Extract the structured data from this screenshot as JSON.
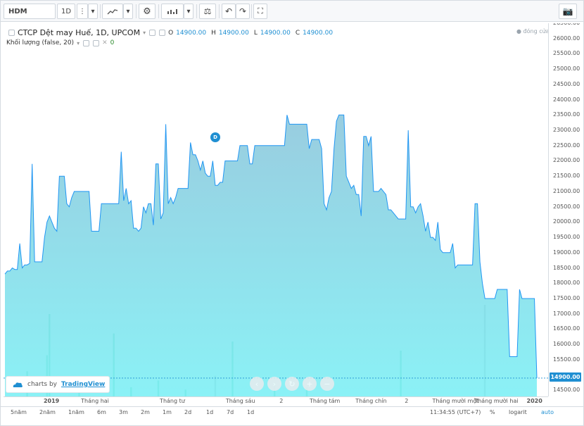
{
  "toolbar": {
    "symbol": "HDM",
    "interval": "1D",
    "icons": [
      "more-dots-icon",
      "chevron-down-icon",
      "line-chart-icon",
      "gear-icon",
      "indicators-icon",
      "compare-scale-icon",
      "undo-icon",
      "redo-icon",
      "fullscreen-icon",
      "camera-icon"
    ]
  },
  "legend": {
    "title": "CTCP Dệt may Huế, 1D, UPCOM",
    "open_key": "O",
    "open": "14900.00",
    "high_key": "H",
    "high": "14900.00",
    "low_key": "L",
    "low": "14900.00",
    "close_key": "C",
    "close": "14900.00",
    "volume_title": "Khối lượng (false, 20)",
    "volume_value": "0",
    "status": "đóng cửa"
  },
  "dividend_marker": "D",
  "current_price": "14900.00",
  "colors": {
    "line": "#2196f3",
    "area_top": "#8ec7dc",
    "area_bottom": "#7ef0f5",
    "volume_up": "#2ec28a",
    "volume_down": "#9ea2a6",
    "accent": "#1f8fd2"
  },
  "chart_data": {
    "type": "area",
    "title": "CTCP Dệt may Huế, 1D, UPCOM",
    "ylim": [
      14300,
      26500
    ],
    "y_ticks": [
      "26500.00",
      "26000.00",
      "25500.00",
      "25000.00",
      "24500.00",
      "24000.00",
      "23500.00",
      "23000.00",
      "22500.00",
      "22000.00",
      "21500.00",
      "21000.00",
      "20500.00",
      "20000.00",
      "19500.00",
      "19000.00",
      "18500.00",
      "18000.00",
      "17500.00",
      "17000.00",
      "16500.00",
      "16000.00",
      "15500.00",
      "15000.00",
      "14500.00"
    ],
    "x_ticks": [
      "2019",
      "Tháng hai",
      "Tháng tư",
      "Tháng sáu",
      "2",
      "Tháng tám",
      "Tháng chín",
      "2",
      "Tháng mười một",
      "Tháng mười hai",
      "2020"
    ],
    "grid": false,
    "series": [
      {
        "name": "",
        "values": [
          18300,
          18400,
          18400,
          18500,
          18450,
          18450,
          19300,
          18500,
          18600,
          18600,
          18650,
          21900,
          18700,
          18700,
          18700,
          18700,
          19500,
          20000,
          20200,
          20000,
          19800,
          19700,
          21500,
          21500,
          21500,
          20600,
          20500,
          20800,
          21000,
          21000,
          21000,
          21000,
          21000,
          21000,
          21000,
          19700,
          19700,
          19700,
          19700,
          20600,
          20600,
          20600,
          20600,
          20600,
          20600,
          20600,
          20600,
          22300,
          20700,
          21100,
          20600,
          20700,
          19800,
          19800,
          19700,
          19800,
          20500,
          20300,
          20600,
          20600,
          19900,
          21900,
          21900,
          20100,
          20300,
          23200,
          20600,
          20800,
          20600,
          20800,
          21100,
          21100,
          21100,
          21100,
          21100,
          22600,
          22200,
          22200,
          22000,
          21700,
          22000,
          21600,
          21500,
          21500,
          22000,
          21200,
          21200,
          21300,
          21300,
          22000,
          22000,
          22000,
          22000,
          22000,
          22000,
          22500,
          22500,
          22500,
          22500,
          21900,
          21900,
          22500,
          22500,
          22500,
          22500,
          22500,
          22500,
          22500,
          22500,
          22500,
          22500,
          22500,
          22500,
          22500,
          23500,
          23200,
          23200,
          23200,
          23200,
          23200,
          23200,
          23200,
          23200,
          22400,
          22700,
          22700,
          22700,
          22700,
          22400,
          20600,
          20400,
          20800,
          21000,
          22400,
          23300,
          23500,
          23500,
          23500,
          21500,
          21300,
          21100,
          21200,
          20900,
          20900,
          20200,
          22800,
          22800,
          22500,
          22800,
          21000,
          21000,
          21000,
          21100,
          21000,
          20900,
          20400,
          20400,
          20300,
          20200,
          20100,
          20100,
          20100,
          20100,
          23000,
          20500,
          20500,
          20300,
          20500,
          20600,
          20200,
          19700,
          20000,
          19500,
          19500,
          19400,
          20000,
          19100,
          19000,
          19000,
          19000,
          19000,
          19300,
          18500,
          18600,
          18600,
          18600,
          18600,
          18600,
          18600,
          18600,
          20600,
          20600,
          18700,
          18000,
          17500,
          17500,
          17500,
          17500,
          17500,
          17800,
          17800,
          17800,
          17800,
          17800,
          15600,
          15600,
          15600,
          15600,
          17800,
          17500,
          17500,
          17500,
          17500,
          17500,
          17500,
          14900
        ]
      },
      {
        "name": "",
        "values": [
          0,
          0,
          0,
          0,
          0,
          0,
          0,
          0,
          0,
          22,
          0,
          0,
          0,
          0,
          0,
          0,
          0,
          36,
          72,
          0,
          0,
          0,
          0,
          0,
          0,
          0,
          0,
          0,
          0,
          0,
          14,
          0,
          0,
          0,
          0,
          0,
          0,
          0,
          0,
          0,
          0,
          0,
          0,
          0,
          55,
          0,
          0,
          0,
          0,
          0,
          0,
          8,
          0,
          0,
          0,
          0,
          0,
          0,
          0,
          0,
          0,
          0,
          14,
          0,
          0,
          0,
          0,
          0,
          0,
          0,
          0,
          0,
          0,
          6,
          0,
          0,
          0,
          0,
          0,
          0,
          0,
          0,
          0,
          0,
          0,
          18,
          0,
          0,
          0,
          0,
          0,
          0,
          48,
          0,
          0,
          0,
          0,
          0,
          0,
          0,
          0,
          0,
          0,
          0,
          0,
          0,
          0,
          0,
          0,
          12,
          0,
          0,
          0,
          0,
          0,
          0,
          0,
          0,
          0,
          0,
          0,
          0,
          8,
          0,
          0,
          0,
          0,
          0,
          0,
          0,
          0,
          0,
          0,
          0,
          0,
          0,
          0,
          0,
          0,
          0,
          0,
          0,
          0,
          0,
          0,
          0,
          0,
          0,
          0,
          0,
          0,
          0,
          0,
          0,
          0,
          0,
          0,
          0,
          0,
          0,
          40,
          0,
          0,
          0,
          0,
          0,
          0,
          0,
          0,
          0,
          0,
          0,
          0,
          0,
          0,
          0,
          0,
          0,
          0,
          0,
          0,
          0,
          0,
          0,
          0,
          0,
          0,
          0,
          0,
          0,
          0,
          0,
          0,
          0,
          80,
          0,
          0,
          0,
          0,
          0,
          0,
          0,
          0,
          0,
          0,
          0,
          0,
          0,
          0,
          0,
          0,
          0,
          0,
          0,
          0,
          0,
          0,
          0,
          0,
          0,
          0,
          0,
          0,
          0,
          0,
          0,
          0,
          0,
          0,
          0,
          0,
          0,
          0,
          0,
          0,
          0
        ]
      }
    ]
  },
  "bottom": {
    "ranges": [
      "5năm",
      "2năm",
      "1năm",
      "6m",
      "3m",
      "2m",
      "1m",
      "2d",
      "1d",
      "7d",
      "1d"
    ],
    "clock": "11:34:55 (UTC+7)",
    "percent": "%",
    "log": "logarit",
    "auto": "auto"
  },
  "branding": {
    "prefix": "charts by",
    "name": "TradingView"
  }
}
